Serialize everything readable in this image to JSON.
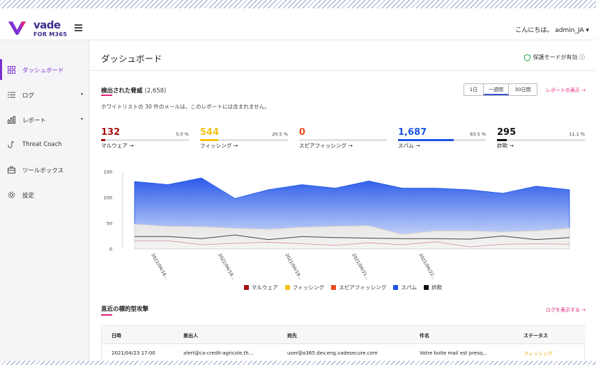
{
  "app": {
    "logo_text": "vade",
    "logo_sub": "FOR M365",
    "greeting": "こんにちは。 admin_JA ▾"
  },
  "sidebar": {
    "items": [
      {
        "label": "ダッシュボード",
        "icon": "grid-icon",
        "active": true
      },
      {
        "label": "ログ",
        "icon": "list-icon",
        "caret": "▾"
      },
      {
        "label": "レポート",
        "icon": "bar-chart-icon",
        "caret": "▾"
      },
      {
        "label": "Threat Coach",
        "icon": "hook-icon"
      },
      {
        "label": "ツールボックス",
        "icon": "toolbox-icon"
      },
      {
        "label": "設定",
        "icon": "gear-icon"
      }
    ]
  },
  "header": {
    "title": "ダッシュボード",
    "protection": "保護モードが有効 ⓘ"
  },
  "threats": {
    "title": "検出された脅威",
    "count": "(2,658)",
    "note": "ホワイトリストの 30 件のメールは、このレポートには含まれません。",
    "ranges": [
      "1日",
      "一週間",
      "30日間"
    ],
    "selected_range": "一週間",
    "report_link": "レポートの表示 →",
    "stats": [
      {
        "value": "132",
        "pct": "5.0 %",
        "label": "マルウェア →",
        "color": "#a81111",
        "fraction": 0.05
      },
      {
        "value": "544",
        "pct": "20.5 %",
        "label": "フィッシング →",
        "color": "#f3c21a",
        "fraction": 0.205
      },
      {
        "value": "0",
        "pct": "",
        "label": "スピアフィッシング →",
        "color": "#e84a1c",
        "fraction": 0.0
      },
      {
        "value": "1,687",
        "pct": "63.5 %",
        "label": "スパム →",
        "color": "#1c54e6",
        "fraction": 0.635
      },
      {
        "value": "295",
        "pct": "11.1 %",
        "label": "詐欺 →",
        "color": "#111111",
        "fraction": 0.111
      }
    ]
  },
  "chart_data": {
    "type": "area",
    "ylim": [
      0,
      150
    ],
    "yticks": [
      0,
      50,
      100,
      150
    ],
    "x_tick_labels": [
      "2021/04/16...",
      "2021/04/18...",
      "2021/04/19...",
      "2021/04/21...",
      "2021/04/22..."
    ],
    "x_tick_positions": [
      0.5,
      2.5,
      4.5,
      6.5,
      8.5
    ],
    "series": [
      {
        "name": "スパム",
        "color": "#1c54e6",
        "values": [
          131,
          125,
          138,
          98,
          115,
          125,
          118,
          132,
          118,
          118,
          115,
          108,
          122,
          115
        ]
      },
      {
        "name": "フィッシング",
        "color": "#f3c21a",
        "values": [
          48,
          44,
          43,
          40,
          38,
          42,
          44,
          45,
          28,
          35,
          35,
          33,
          35,
          40
        ]
      },
      {
        "name": "詐欺",
        "color": "#111111",
        "values": [
          24,
          24,
          20,
          27,
          18,
          24,
          22,
          21,
          20,
          20,
          19,
          25,
          18,
          22
        ]
      },
      {
        "name": "マルウェア",
        "color": "#a81111",
        "values": [
          16,
          16,
          8,
          11,
          13,
          10,
          7,
          12,
          8,
          14,
          4,
          9,
          10,
          9
        ]
      },
      {
        "name": "スピアフィッシング",
        "color": "#e84a1c",
        "values": [
          0,
          0,
          0,
          0,
          0,
          0,
          0,
          0,
          0,
          0,
          0,
          0,
          0,
          0
        ]
      }
    ],
    "legend": [
      {
        "name": "マルウェア",
        "color": "#a81111"
      },
      {
        "name": "フィッシング",
        "color": "#f3c21a"
      },
      {
        "name": "スピアフィッシング",
        "color": "#e84a1c"
      },
      {
        "name": "スパム",
        "color": "#1c54e6"
      },
      {
        "name": "詐欺",
        "color": "#111111"
      }
    ]
  },
  "attacks": {
    "title": "直近の標的型攻撃",
    "link": "ログを表示する →",
    "columns": [
      "日時",
      "差出人",
      "宛先",
      "件名",
      "ステータス"
    ],
    "rows": [
      {
        "date": "2021/04/23 17:00",
        "from": "alert@ca-credit-agricole.th...",
        "to": "user@o365.dev.eng.vadesecure.com",
        "subject": "Votre boite mail est presq...",
        "status": "フィッシング"
      }
    ]
  }
}
